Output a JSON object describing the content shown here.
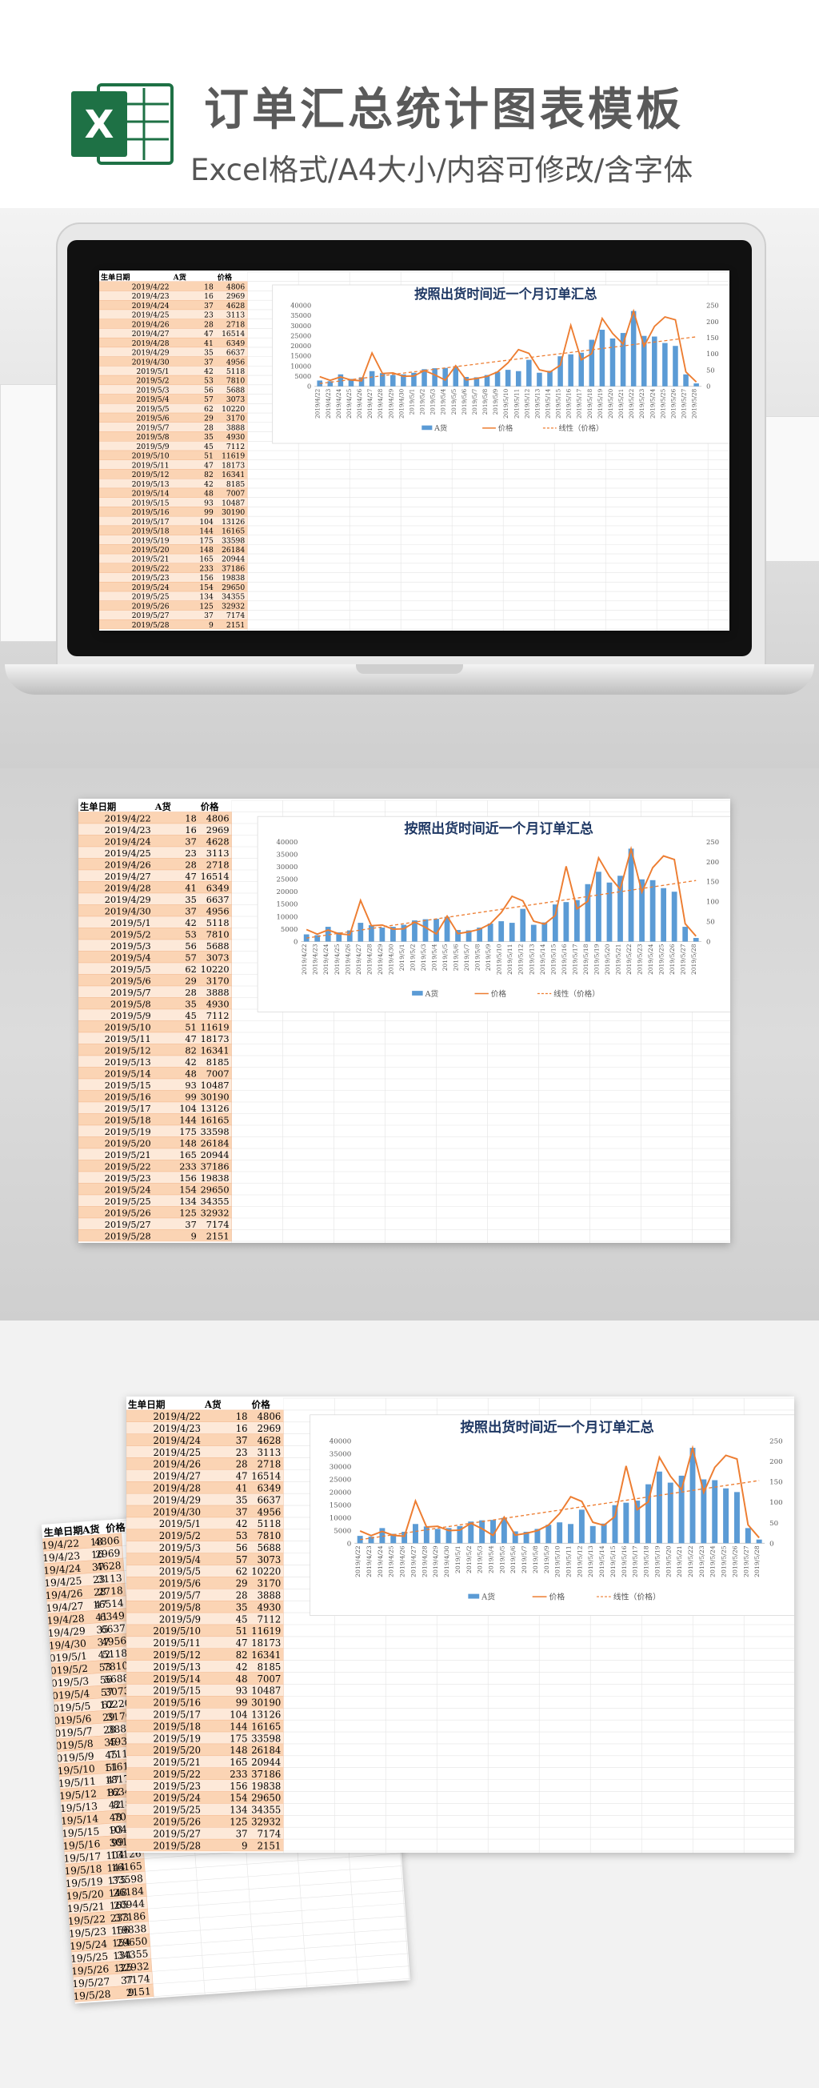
{
  "header": {
    "title": "订单汇总统计图表模板",
    "subtitle": "Excel格式/A4大小/内容可修改/含字体"
  },
  "logo": {
    "letter": "X"
  },
  "table": {
    "headers": [
      "生单日期",
      "A货",
      "价格"
    ],
    "rows": [
      [
        "2019/4/22",
        "18",
        "4806"
      ],
      [
        "2019/4/23",
        "16",
        "2969"
      ],
      [
        "2019/4/24",
        "37",
        "4628"
      ],
      [
        "2019/4/25",
        "23",
        "3113"
      ],
      [
        "2019/4/26",
        "28",
        "2718"
      ],
      [
        "2019/4/27",
        "47",
        "16514"
      ],
      [
        "2019/4/28",
        "41",
        "6349"
      ],
      [
        "2019/4/29",
        "35",
        "6637"
      ],
      [
        "2019/4/30",
        "37",
        "4956"
      ],
      [
        "2019/5/1",
        "42",
        "5118"
      ],
      [
        "2019/5/2",
        "53",
        "7810"
      ],
      [
        "2019/5/3",
        "56",
        "5688"
      ],
      [
        "2019/5/4",
        "57",
        "3073"
      ],
      [
        "2019/5/5",
        "62",
        "10220"
      ],
      [
        "2019/5/6",
        "29",
        "3170"
      ],
      [
        "2019/5/7",
        "28",
        "3888"
      ],
      [
        "2019/5/8",
        "35",
        "4930"
      ],
      [
        "2019/5/9",
        "45",
        "7112"
      ],
      [
        "2019/5/10",
        "51",
        "11619"
      ],
      [
        "2019/5/11",
        "47",
        "18173"
      ],
      [
        "2019/5/12",
        "82",
        "16341"
      ],
      [
        "2019/5/13",
        "42",
        "8185"
      ],
      [
        "2019/5/14",
        "48",
        "7007"
      ],
      [
        "2019/5/15",
        "93",
        "10487"
      ],
      [
        "2019/5/16",
        "99",
        "30190"
      ],
      [
        "2019/5/17",
        "104",
        "13126"
      ],
      [
        "2019/5/18",
        "144",
        "16165"
      ],
      [
        "2019/5/19",
        "175",
        "33598"
      ],
      [
        "2019/5/20",
        "148",
        "26184"
      ],
      [
        "2019/5/21",
        "165",
        "20944"
      ],
      [
        "2019/5/22",
        "233",
        "37186"
      ],
      [
        "2019/5/23",
        "156",
        "19838"
      ],
      [
        "2019/5/24",
        "154",
        "29650"
      ],
      [
        "2019/5/25",
        "134",
        "34355"
      ],
      [
        "2019/5/26",
        "125",
        "32932"
      ],
      [
        "2019/5/27",
        "37",
        "7174"
      ],
      [
        "2019/5/28",
        "9",
        "2151"
      ]
    ]
  },
  "chart_data": {
    "type": "bar",
    "title": "按照出货时间近一个月订单汇总",
    "categories": [
      "2019/4/22",
      "2019/4/23",
      "2019/4/24",
      "2019/4/25",
      "2019/4/26",
      "2019/4/27",
      "2019/4/28",
      "2019/4/29",
      "2019/4/30",
      "2019/5/1",
      "2019/5/2",
      "2019/5/3",
      "2019/5/4",
      "2019/5/5",
      "2019/5/6",
      "2019/5/7",
      "2019/5/8",
      "2019/5/9",
      "2019/5/10",
      "2019/5/11",
      "2019/5/12",
      "2019/5/13",
      "2019/5/14",
      "2019/5/15",
      "2019/5/16",
      "2019/5/17",
      "2019/5/18",
      "2019/5/19",
      "2019/5/20",
      "2019/5/21",
      "2019/5/22",
      "2019/5/23",
      "2019/5/24",
      "2019/5/25",
      "2019/5/26",
      "2019/5/27",
      "2019/5/28"
    ],
    "series": [
      {
        "name": "A货",
        "type": "bar",
        "axis": "right",
        "color": "#5b9bd5",
        "values": [
          18,
          16,
          37,
          23,
          28,
          47,
          41,
          35,
          37,
          42,
          53,
          56,
          57,
          62,
          29,
          28,
          35,
          45,
          51,
          47,
          82,
          42,
          48,
          93,
          99,
          104,
          144,
          175,
          148,
          165,
          233,
          156,
          154,
          134,
          125,
          37,
          9
        ]
      },
      {
        "name": "价格",
        "type": "line",
        "axis": "left",
        "color": "#ed7d31",
        "values": [
          4806,
          2969,
          4628,
          3113,
          2718,
          16514,
          6349,
          6637,
          4956,
          5118,
          7810,
          5688,
          3073,
          10220,
          3170,
          3888,
          4930,
          7112,
          11619,
          18173,
          16341,
          8185,
          7007,
          10487,
          30190,
          13126,
          16165,
          33598,
          26184,
          20944,
          37186,
          19838,
          29650,
          34355,
          32932,
          7174,
          2151
        ]
      },
      {
        "name": "线性（价格）",
        "type": "trendline",
        "axis": "left",
        "color": "#ed7d31"
      }
    ],
    "y_left": {
      "range": [
        0,
        40000
      ],
      "ticks": [
        "0",
        "5000",
        "10000",
        "15000",
        "20000",
        "25000",
        "30000",
        "35000",
        "40000"
      ]
    },
    "y_right": {
      "range": [
        0,
        250
      ],
      "ticks": [
        "0",
        "50",
        "100",
        "150",
        "200",
        "250"
      ]
    },
    "legend": "bottom",
    "grid": false
  },
  "colors": {
    "header_fill": "#fbd4b4",
    "row_alt": "#fde9d9",
    "excel_green": "#1e7145"
  }
}
